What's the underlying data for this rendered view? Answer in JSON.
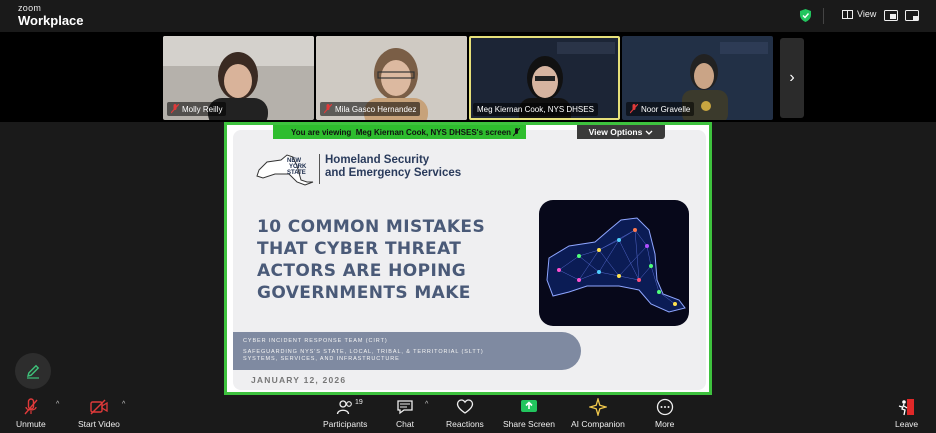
{
  "app": {
    "brand_small": "zoom",
    "brand_large": "Workplace"
  },
  "topbar": {
    "view_label": "View"
  },
  "participants": [
    {
      "name": "Molly Reilly",
      "muted": true
    },
    {
      "name": "Mila Gasco Hernandez",
      "muted": true
    },
    {
      "name": "Meg Kiernan Cook, NYS DHSES",
      "muted": false
    },
    {
      "name": "Noor Gravelle",
      "muted": true
    }
  ],
  "share": {
    "viewing_prefix": "You are viewing",
    "viewing_name": "Meg Kiernan Cook, NYS DHSES's screen",
    "view_options": "View Options"
  },
  "slide": {
    "logo_line1": "NEW",
    "logo_line2": "YORK",
    "logo_line3": "STATE",
    "org_line1": "Homeland Security",
    "org_line2": "and Emergency Services",
    "title_lines": [
      "10 COMMON MISTAKES",
      "THAT CYBER THREAT",
      "ACTORS ARE HOPING",
      "GOVERNMENTS MAKE"
    ],
    "cirt_line1": "CYBER INCIDENT RESPONSE TEAM (CIRT)",
    "cirt_line2": "SAFEGUARDING NYS'S STATE, LOCAL, TRIBAL, & TERRITORIAL (SLTT)",
    "cirt_line3": "SYSTEMS, SERVICES, AND INFRASTRUCTURE",
    "date": "JANUARY 12, 2026"
  },
  "toolbar": {
    "unmute": "Unmute",
    "start_video": "Start Video",
    "participants": "Participants",
    "participants_count": "19",
    "chat": "Chat",
    "reactions": "Reactions",
    "share_screen": "Share Screen",
    "ai_companion": "AI Companion",
    "more": "More",
    "leave": "Leave"
  },
  "colors": {
    "share_border": "#3ec23e",
    "share_btn": "#22c55e",
    "title": "#4a5a78",
    "leave": "#e02828"
  }
}
